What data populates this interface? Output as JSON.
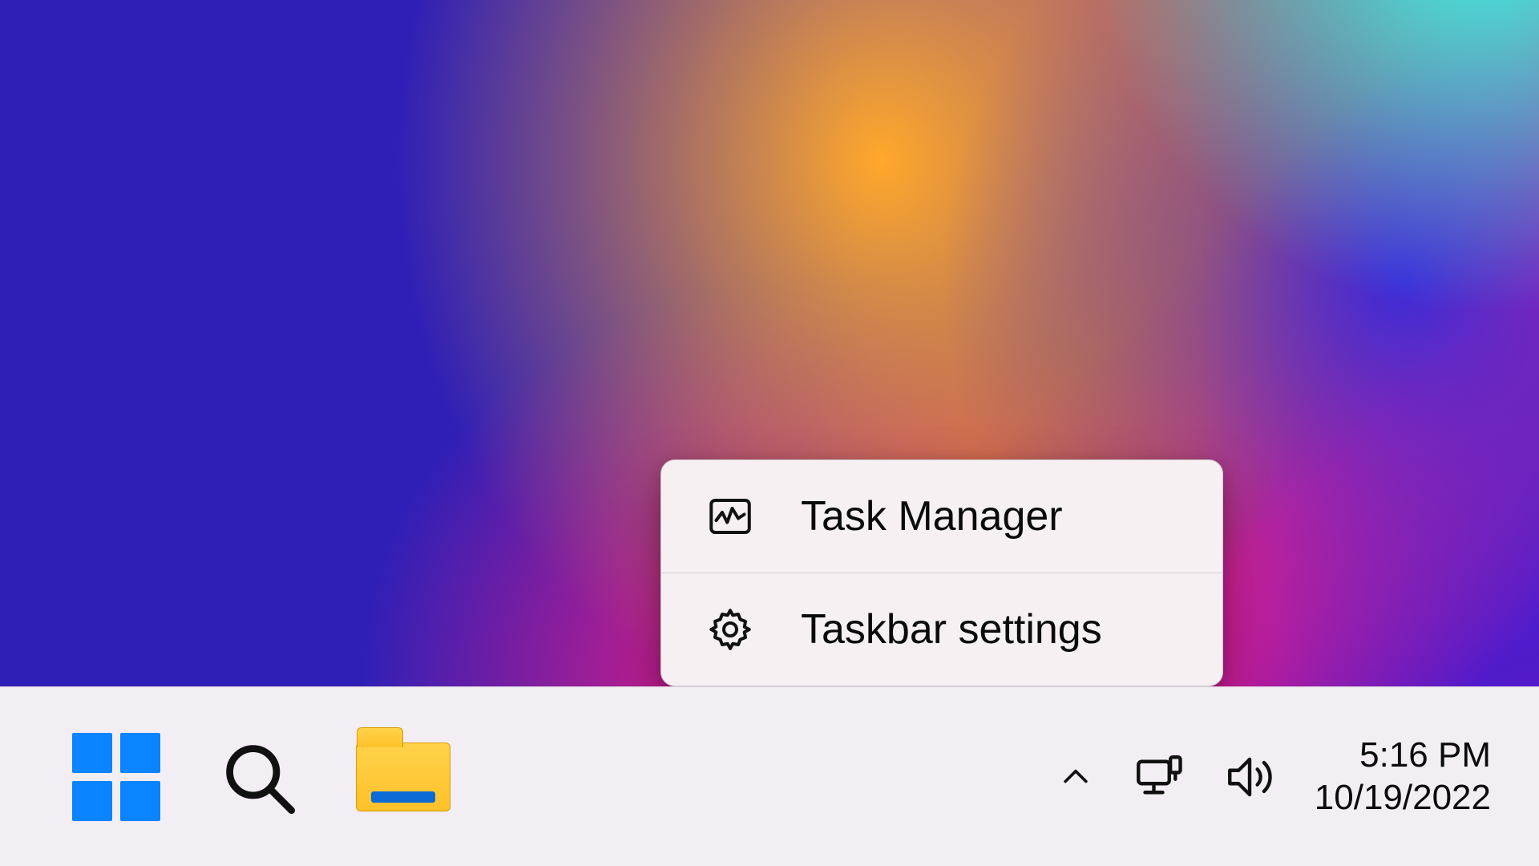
{
  "context_menu": {
    "items": [
      {
        "icon": "task-manager-icon",
        "label": "Task Manager"
      },
      {
        "icon": "gear-icon",
        "label": "Taskbar settings"
      }
    ]
  },
  "taskbar": {
    "pinned": [
      {
        "name": "start",
        "label": "Start"
      },
      {
        "name": "search",
        "label": "Search"
      },
      {
        "name": "file-explorer",
        "label": "File Explorer"
      }
    ],
    "tray": {
      "overflow_icon": "chevron-up-icon",
      "network_icon": "ethernet-icon",
      "volume_icon": "volume-icon"
    },
    "clock": {
      "time": "5:16 PM",
      "date": "10/19/2022"
    }
  }
}
